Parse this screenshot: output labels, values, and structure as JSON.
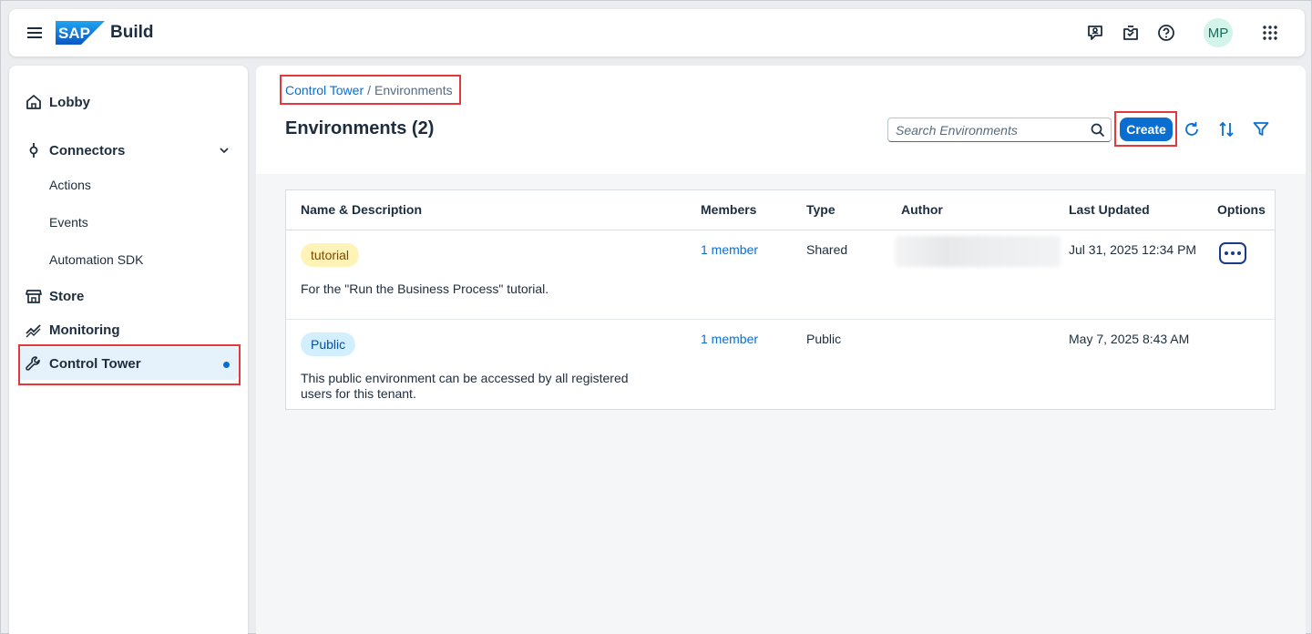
{
  "shell": {
    "product_name": "Build",
    "logo_text": "SAP",
    "avatar_initials": "MP",
    "icons": [
      "menu-icon",
      "feedback-icon",
      "notifications-inbox-icon",
      "help-icon",
      "app-grid-icon"
    ]
  },
  "sidebar": {
    "items": [
      {
        "label": "Lobby",
        "icon": "home-icon"
      },
      {
        "label": "Connectors",
        "icon": "connector-icon",
        "expanded": true
      },
      {
        "label": "Actions"
      },
      {
        "label": "Events"
      },
      {
        "label": "Automation SDK"
      },
      {
        "label": "Store",
        "icon": "store-icon"
      },
      {
        "label": "Monitoring",
        "icon": "monitoring-icon"
      },
      {
        "label": "Control Tower",
        "icon": "wrench-icon",
        "selected": true
      }
    ]
  },
  "breadcrumb": {
    "link": "Control Tower",
    "separator": "/",
    "current": "Environments"
  },
  "page": {
    "title": "Environments (2)",
    "search_placeholder": "Search Environments",
    "create_label": "Create"
  },
  "table": {
    "headers": [
      "Name & Description",
      "Members",
      "Type",
      "Author",
      "Last Updated",
      "Options"
    ],
    "rows": [
      {
        "tag": "tutorial",
        "description": "For the \"Run the Business Process\" tutorial.",
        "members": "1 member",
        "type": "Shared",
        "author": "",
        "last_updated": "Jul 31, 2025 12:34 PM",
        "has_options": true
      },
      {
        "tag": "Public",
        "description": "This public environment can be accessed by all registered users for this tenant.",
        "members": "1 member",
        "type": "Public",
        "author": "",
        "last_updated": "May 7, 2025 8:43 AM",
        "has_options": false
      }
    ]
  },
  "colors": {
    "accent": "#0a6ed1",
    "highlight_box": "#e3383c",
    "tutorial_tag_bg": "#fff3b8",
    "public_tag_bg": "#d1efff"
  }
}
